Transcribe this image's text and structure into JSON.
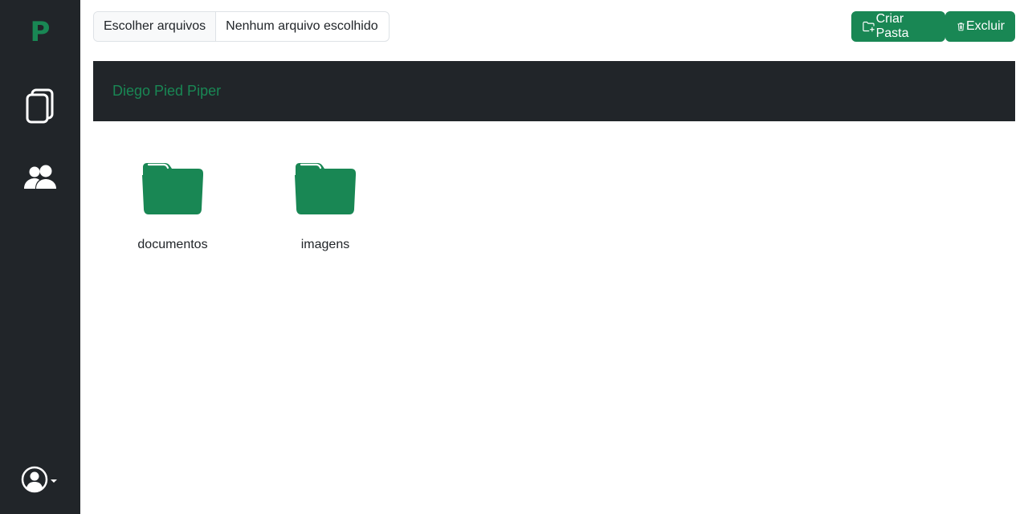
{
  "sidebar": {
    "brand": "P",
    "items": [
      {
        "icon": "files-icon"
      },
      {
        "icon": "people-icon"
      }
    ],
    "user_menu_icon": "person-circle-icon"
  },
  "toolbar": {
    "choose_files_label": "Escolher arquivos",
    "no_file_label": "Nenhum arquivo escolhido",
    "create_folder_label": "Criar Pasta",
    "delete_label": "Excluir"
  },
  "header": {
    "title": "Diego Pied Piper"
  },
  "folders": [
    {
      "name": "documentos",
      "icon": "folder-icon"
    },
    {
      "name": "imagens",
      "icon": "folder-icon"
    }
  ],
  "colors": {
    "accent": "#198754",
    "dark": "#212529"
  }
}
